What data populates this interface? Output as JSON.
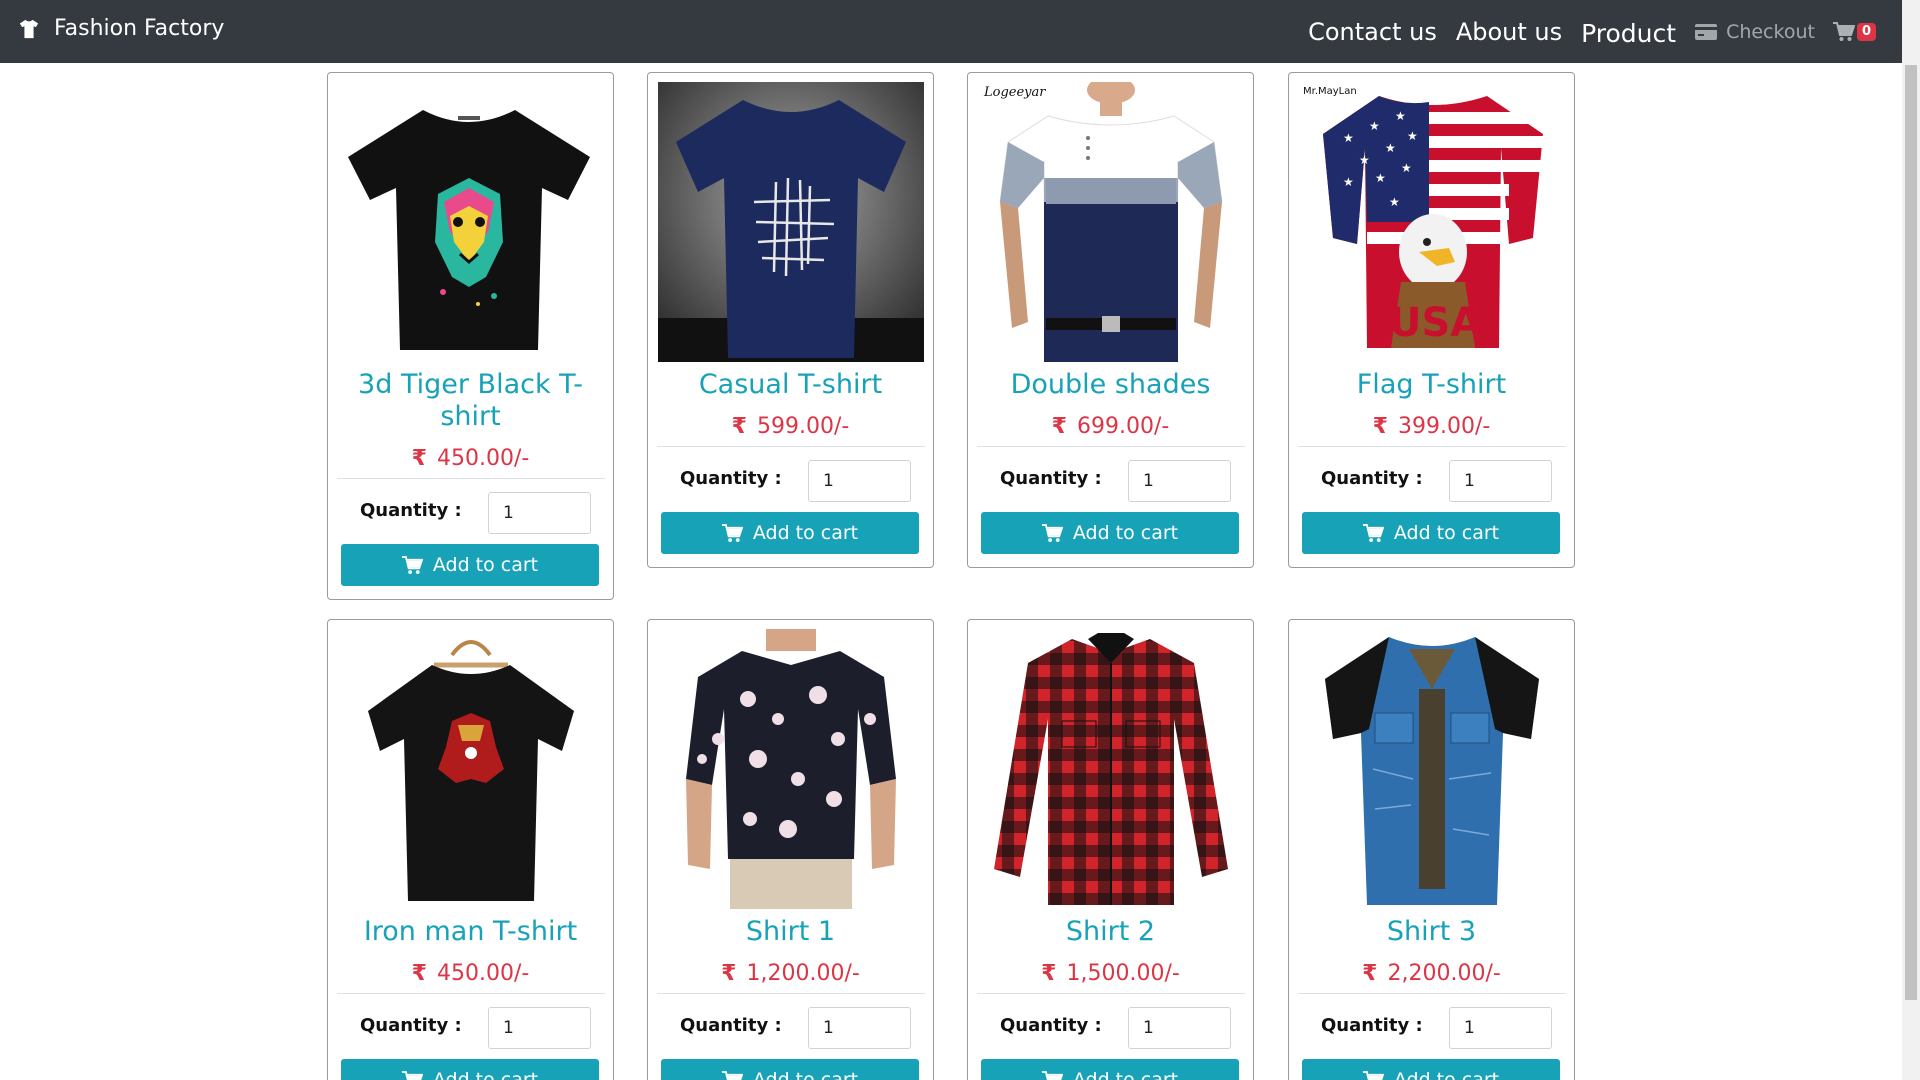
{
  "navbar": {
    "brand": "Fashion Factory",
    "links": {
      "contact": "Contact us",
      "about": "About us",
      "product": "Product"
    },
    "checkout": "Checkout",
    "cart_count": "0"
  },
  "currency_symbol": "₹",
  "quantity_label": "Quantity :",
  "add_to_cart_label": "Add to cart",
  "products": [
    {
      "title": "3d Tiger Black T-shirt",
      "price": "450.00/-",
      "quantity": "1"
    },
    {
      "title": "Casual T-shirt",
      "price": "599.00/-",
      "quantity": "1"
    },
    {
      "title": "Double shades",
      "price": "699.00/-",
      "quantity": "1"
    },
    {
      "title": "Flag T-shirt",
      "price": "399.00/-",
      "quantity": "1"
    },
    {
      "title": "Iron man T-shirt",
      "price": "450.00/-",
      "quantity": "1"
    },
    {
      "title": "Shirt 1",
      "price": "1,200.00/-",
      "quantity": "1"
    },
    {
      "title": "Shirt 2",
      "price": "1,500.00/-",
      "quantity": "1"
    },
    {
      "title": "Shirt 3",
      "price": "2,200.00/-",
      "quantity": "1"
    }
  ],
  "image_brand_marks": {
    "double_shades": "Logeeyar",
    "flag_tshirt": "Mr.MayLan"
  },
  "colors": {
    "navbar": "#343a40",
    "accent": "#17a2b8",
    "price": "#dc3545",
    "badge": "#dc3545"
  }
}
